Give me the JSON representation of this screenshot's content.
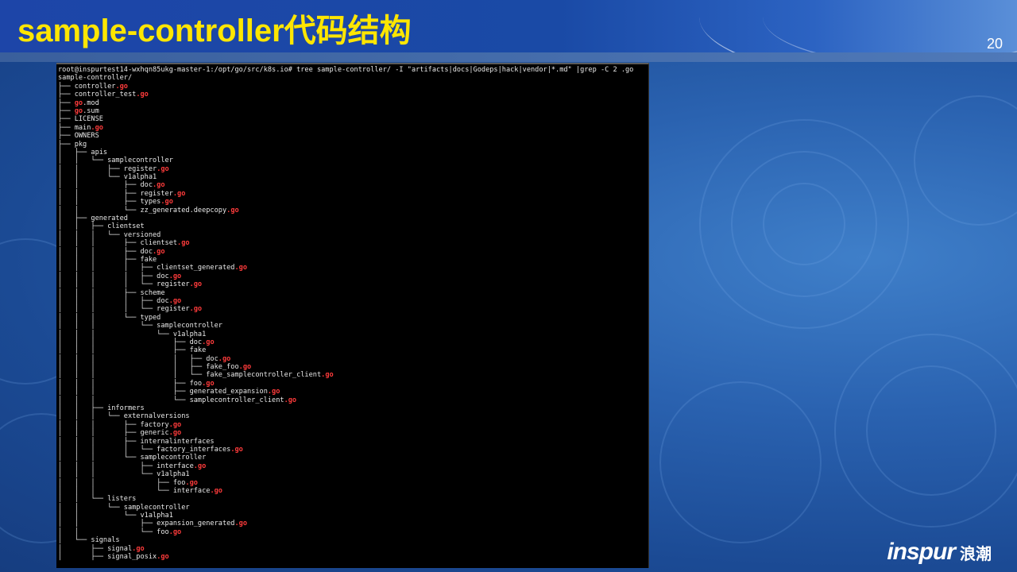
{
  "slide": {
    "title": "sample-controller代码结构",
    "page_number": "20",
    "logo_brand": "inspur",
    "logo_cn": "浪潮"
  },
  "terminal": {
    "lines": [
      {
        "prefix": "root@inspurtest14-wxhqn85ukg-master-1:/opt/go/src/k8s.io# tree sample-controller/ -I \"artifacts|docs|Godeps|hack|vendor|*.md\" |grep -C 2 .go",
        "ext": ""
      },
      {
        "prefix": "sample-controller/",
        "ext": ""
      },
      {
        "prefix": "├── controller",
        "ext": ".go"
      },
      {
        "prefix": "├── controller_test",
        "ext": ".go"
      },
      {
        "prefix": "├── ",
        "ext": "go",
        "suffix": ".mod"
      },
      {
        "prefix": "├── ",
        "ext": "go",
        "suffix": ".sum"
      },
      {
        "prefix": "├── LICENSE",
        "ext": ""
      },
      {
        "prefix": "├── main",
        "ext": ".go"
      },
      {
        "prefix": "├── OWNERS",
        "ext": ""
      },
      {
        "prefix": "├── pkg",
        "ext": ""
      },
      {
        "prefix": "│   ├── apis",
        "ext": ""
      },
      {
        "prefix": "│   │   └── samplecontroller",
        "ext": ""
      },
      {
        "prefix": "│   │       ├── register",
        "ext": ".go"
      },
      {
        "prefix": "│   │       └── v1alpha1",
        "ext": ""
      },
      {
        "prefix": "│   │           ├── doc",
        "ext": ".go"
      },
      {
        "prefix": "│   │           ├── register",
        "ext": ".go"
      },
      {
        "prefix": "│   │           ├── types",
        "ext": ".go"
      },
      {
        "prefix": "│   │           └── zz_generated.deepcopy",
        "ext": ".go"
      },
      {
        "prefix": "│   ├── generated",
        "ext": ""
      },
      {
        "prefix": "│   │   ├── clientset",
        "ext": ""
      },
      {
        "prefix": "│   │   │   └── versioned",
        "ext": ""
      },
      {
        "prefix": "│   │   │       ├── clientset",
        "ext": ".go"
      },
      {
        "prefix": "│   │   │       ├── doc",
        "ext": ".go"
      },
      {
        "prefix": "│   │   │       ├── fake",
        "ext": ""
      },
      {
        "prefix": "│   │   │       │   ├── clientset_generated",
        "ext": ".go"
      },
      {
        "prefix": "│   │   │       │   ├── doc",
        "ext": ".go"
      },
      {
        "prefix": "│   │   │       │   └── register",
        "ext": ".go"
      },
      {
        "prefix": "│   │   │       ├── scheme",
        "ext": ""
      },
      {
        "prefix": "│   │   │       │   ├── doc",
        "ext": ".go"
      },
      {
        "prefix": "│   │   │       │   └── register",
        "ext": ".go"
      },
      {
        "prefix": "│   │   │       └── typed",
        "ext": ""
      },
      {
        "prefix": "│   │   │           └── samplecontroller",
        "ext": ""
      },
      {
        "prefix": "│   │   │               └── v1alpha1",
        "ext": ""
      },
      {
        "prefix": "│   │   │                   ├── doc",
        "ext": ".go"
      },
      {
        "prefix": "│   │   │                   ├── fake",
        "ext": ""
      },
      {
        "prefix": "│   │   │                   │   ├── doc",
        "ext": ".go"
      },
      {
        "prefix": "│   │   │                   │   ├── fake_foo",
        "ext": ".go"
      },
      {
        "prefix": "│   │   │                   │   └── fake_samplecontroller_client",
        "ext": ".go"
      },
      {
        "prefix": "│   │   │                   ├── foo",
        "ext": ".go"
      },
      {
        "prefix": "│   │   │                   ├── generated_expansion",
        "ext": ".go"
      },
      {
        "prefix": "│   │   │                   └── samplecontroller_client",
        "ext": ".go"
      },
      {
        "prefix": "│   │   ├── informers",
        "ext": ""
      },
      {
        "prefix": "│   │   │   └── externalversions",
        "ext": ""
      },
      {
        "prefix": "│   │   │       ├── factory",
        "ext": ".go"
      },
      {
        "prefix": "│   │   │       ├── generic",
        "ext": ".go"
      },
      {
        "prefix": "│   │   │       ├── internalinterfaces",
        "ext": ""
      },
      {
        "prefix": "│   │   │       │   └── factory_interfaces",
        "ext": ".go"
      },
      {
        "prefix": "│   │   │       └── samplecontroller",
        "ext": ""
      },
      {
        "prefix": "│   │   │           ├── interface",
        "ext": ".go"
      },
      {
        "prefix": "│   │   │           └── v1alpha1",
        "ext": ""
      },
      {
        "prefix": "│   │   │               ├── foo",
        "ext": ".go"
      },
      {
        "prefix": "│   │   │               └── interface",
        "ext": ".go"
      },
      {
        "prefix": "│   │   └── listers",
        "ext": ""
      },
      {
        "prefix": "│   │       └── samplecontroller",
        "ext": ""
      },
      {
        "prefix": "│   │           └── v1alpha1",
        "ext": ""
      },
      {
        "prefix": "│   │               ├── expansion_generated",
        "ext": ".go"
      },
      {
        "prefix": "│   │               └── foo",
        "ext": ".go"
      },
      {
        "prefix": "│   └── signals",
        "ext": ""
      },
      {
        "prefix": "│       ├── signal",
        "ext": ".go"
      },
      {
        "prefix": "│       ├── signal_posix",
        "ext": ".go"
      }
    ]
  },
  "colors": {
    "title_yellow": "#ffe600",
    "go_extension_red": "#ff3b3b",
    "terminal_bg": "#000000"
  }
}
